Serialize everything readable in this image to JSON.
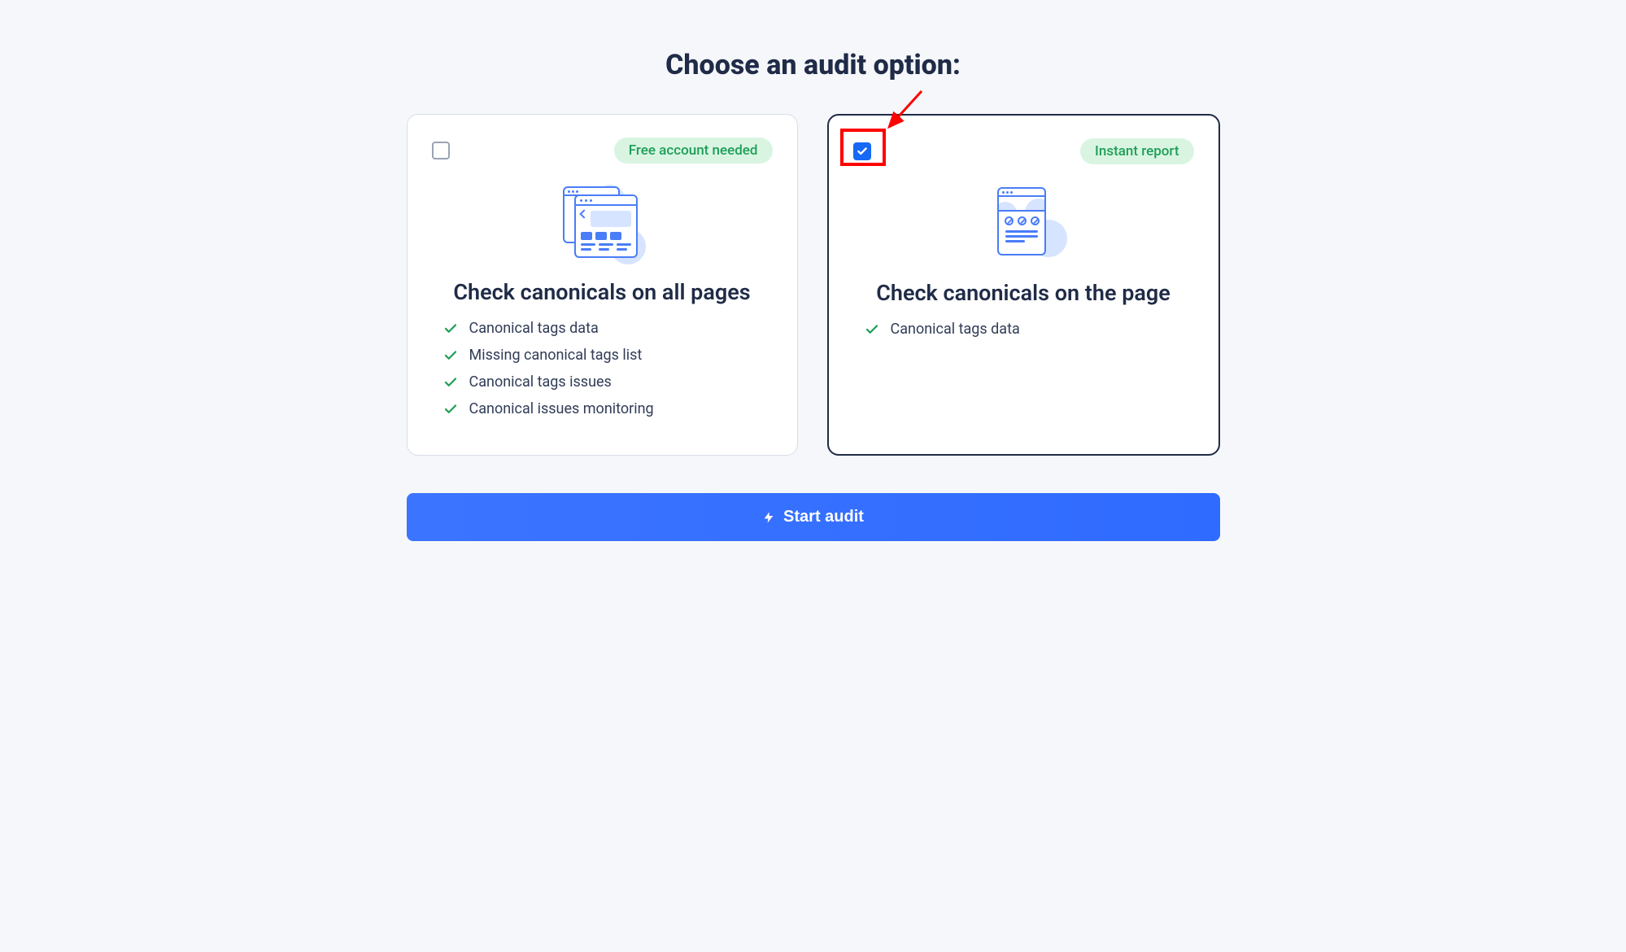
{
  "heading": "Choose an audit option:",
  "cards": [
    {
      "badge": "Free account needed",
      "title": "Check canonicals on all pages",
      "checked": false,
      "features": [
        "Canonical tags data",
        "Missing canonical tags list",
        "Canonical tags issues",
        "Canonical issues monitoring"
      ]
    },
    {
      "badge": "Instant report",
      "title": "Check canonicals on the page",
      "checked": true,
      "features": [
        "Canonical tags data"
      ]
    }
  ],
  "start_button_label": "Start audit"
}
